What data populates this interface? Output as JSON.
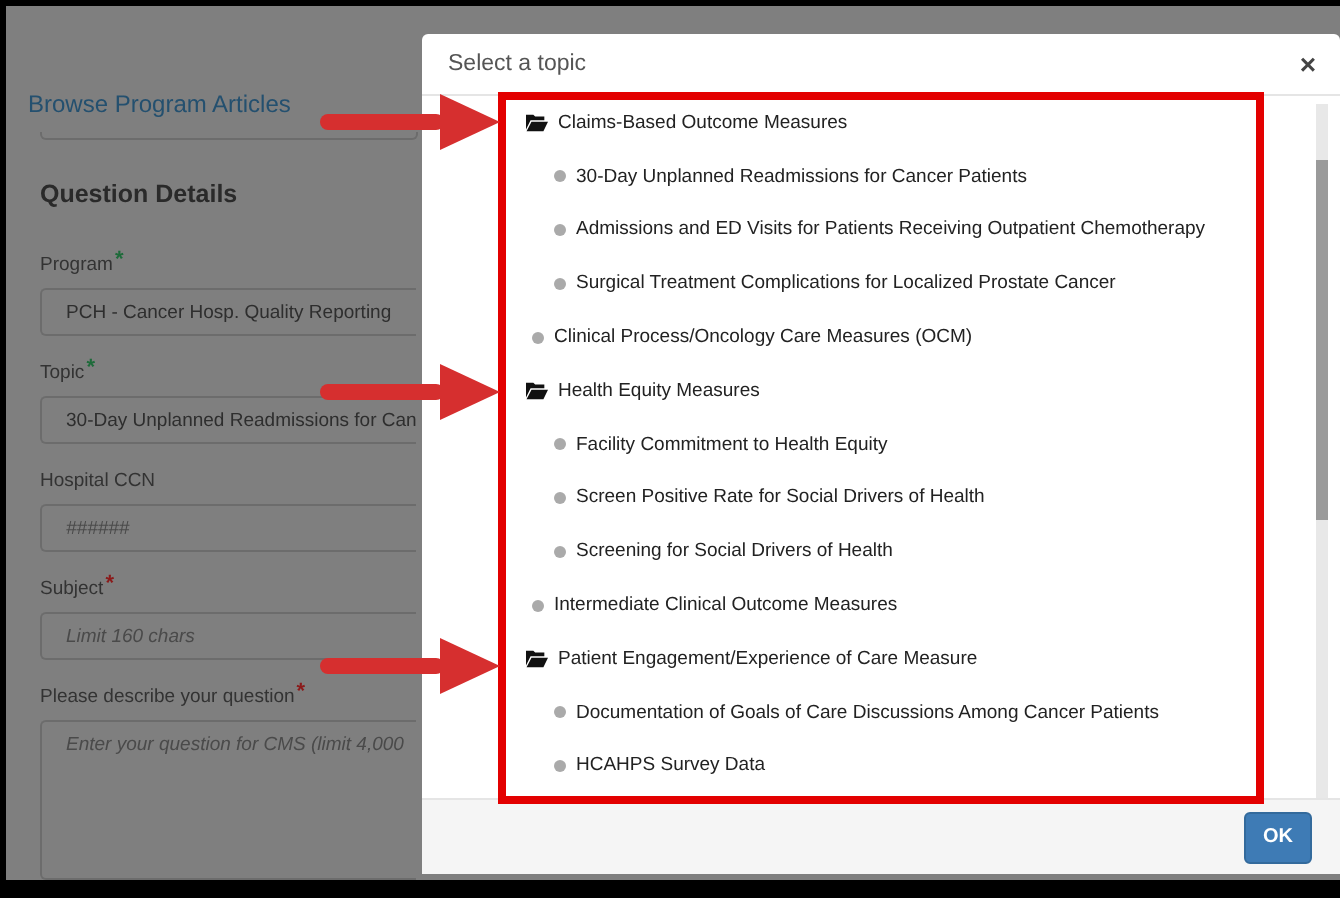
{
  "form": {
    "link": "Browse Program Articles",
    "section_title": "Question Details",
    "fields": [
      {
        "label": "Program",
        "asterisk": "*",
        "color": "#1e6b3a",
        "kind": "input",
        "value": "PCH - Cancer Hosp. Quality Reporting"
      },
      {
        "label": "Topic",
        "asterisk": "*",
        "color": "#1e6b3a",
        "kind": "input",
        "value": "30-Day Unplanned Readmissions for Can"
      },
      {
        "label": "Hospital CCN",
        "kind": "input",
        "placeholder": "######"
      },
      {
        "label": "Subject",
        "asterisk": "*",
        "color": "#8b1a1a",
        "kind": "input",
        "placeholder": "Limit 160 chars"
      },
      {
        "label": "Please describe your question",
        "asterisk": "*",
        "color": "#8b1a1a",
        "kind": "textarea",
        "placeholder": "Enter your question for CMS (limit 4,000"
      }
    ]
  },
  "dialog": {
    "title": "Select a topic",
    "close": "×",
    "ok": "OK",
    "topics": [
      {
        "label": "Claims-Based Outcome Measures",
        "kind": "folder",
        "children": [
          {
            "label": "30-Day Unplanned Readmissions for Cancer Patients",
            "kind": "leaf"
          },
          {
            "label": "Admissions and ED Visits for Patients Receiving Outpatient Chemotherapy",
            "kind": "leaf"
          },
          {
            "label": "Surgical Treatment Complications for Localized Prostate Cancer",
            "kind": "leaf"
          }
        ]
      },
      {
        "label": "Clinical Process/Oncology Care Measures (OCM)",
        "kind": "leaf"
      },
      {
        "label": "Health Equity Measures",
        "kind": "folder",
        "children": [
          {
            "label": "Facility Commitment to Health Equity",
            "kind": "leaf"
          },
          {
            "label": "Screen Positive Rate for Social Drivers of Health",
            "kind": "leaf"
          },
          {
            "label": "Screening for Social Drivers of Health",
            "kind": "leaf"
          }
        ]
      },
      {
        "label": "Intermediate Clinical Outcome Measures",
        "kind": "leaf"
      },
      {
        "label": "Patient Engagement/Experience of Care Measure",
        "kind": "folder",
        "children": [
          {
            "label": "Documentation of Goals of Care Discussions Among Cancer Patients",
            "kind": "leaf"
          },
          {
            "label": "HCAHPS Survey Data",
            "kind": "leaf"
          }
        ]
      }
    ]
  }
}
